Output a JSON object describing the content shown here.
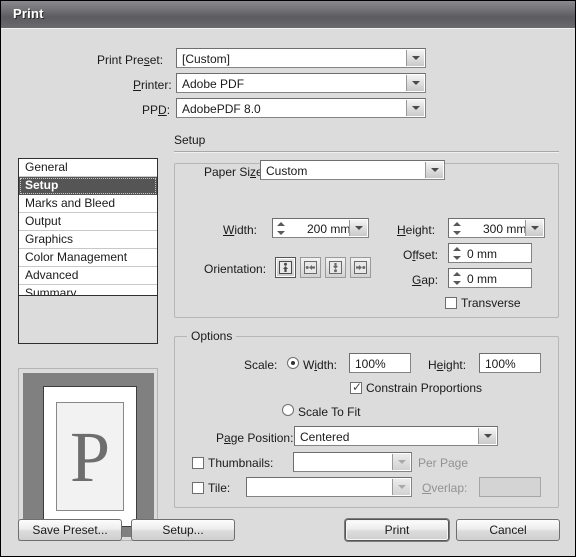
{
  "window": {
    "title": "Print"
  },
  "top_fields": [
    {
      "label": "Print Preset:",
      "accel": "s",
      "value": "[Custom]"
    },
    {
      "label": "Printer:",
      "accel": "P",
      "value": "Adobe PDF"
    },
    {
      "label": "PPD:",
      "accel": "D",
      "value": "AdobePDF 8.0"
    }
  ],
  "sidebar": {
    "items": [
      {
        "label": "General",
        "selected": false
      },
      {
        "label": "Setup",
        "selected": true
      },
      {
        "label": "Marks and Bleed",
        "selected": false
      },
      {
        "label": "Output",
        "selected": false
      },
      {
        "label": "Graphics",
        "selected": false
      },
      {
        "label": "Color Management",
        "selected": false
      },
      {
        "label": "Advanced",
        "selected": false
      },
      {
        "label": "Summary",
        "selected": false
      }
    ]
  },
  "preview": {
    "glyph": "P"
  },
  "setup": {
    "title": "Setup",
    "paper_size": {
      "label": "Paper Size:",
      "value": "Custom"
    },
    "width": {
      "label": "Width:",
      "value": "200 mm"
    },
    "height": {
      "label": "Height:",
      "value": "300 mm"
    },
    "offset": {
      "label": "Offset:",
      "value": "0 mm"
    },
    "gap": {
      "label": "Gap:",
      "value": "0 mm"
    },
    "orientation": {
      "label": "Orientation:",
      "buttons": [
        {
          "name": "portrait",
          "selected": true
        },
        {
          "name": "landscape",
          "selected": false
        },
        {
          "name": "reverse-portrait",
          "selected": false
        },
        {
          "name": "reverse-landscape",
          "selected": false
        }
      ]
    },
    "transverse": {
      "label": "Transverse",
      "checked": false
    }
  },
  "options": {
    "title": "Options",
    "scale_label": "Scale:",
    "scale_width": {
      "label": "Width:",
      "value": "100%",
      "selected": true
    },
    "scale_height": {
      "label": "Height:",
      "value": "100%"
    },
    "constrain": {
      "label": "Constrain Proportions",
      "checked": true
    },
    "scale_to_fit": {
      "label": "Scale To Fit",
      "selected": false
    },
    "page_position": {
      "label": "Page Position:",
      "value": "Centered"
    },
    "thumbnails": {
      "label": "Thumbnails:",
      "checked": false,
      "value": "",
      "suffix": "Per Page"
    },
    "tile": {
      "label": "Tile:",
      "checked": false,
      "value": "",
      "overlap_label": "Overlap:",
      "overlap_value": ""
    }
  },
  "footer": {
    "save_preset": "Save Preset...",
    "setup": "Setup...",
    "print": "Print",
    "cancel": "Cancel"
  }
}
